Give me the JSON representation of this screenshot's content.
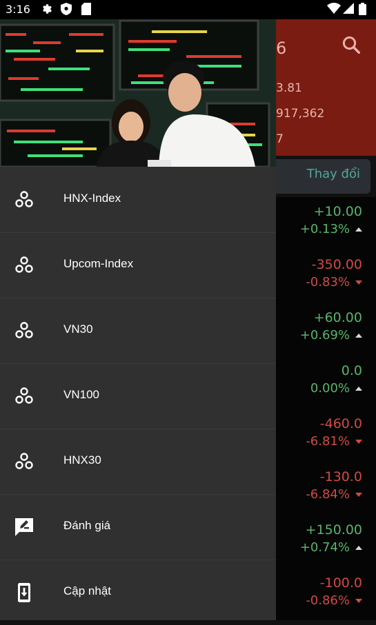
{
  "status_bar": {
    "time": "3:16",
    "icons": [
      "gear-icon",
      "shield-icon",
      "sim-card-icon",
      "wifi-icon",
      "signal-icon",
      "battery-icon"
    ]
  },
  "background": {
    "header_values": [
      "6",
      "3.81",
      "917,362",
      "7"
    ],
    "column_header": "Thay đổi",
    "rows": [
      {
        "value": "+10.00",
        "percent": "+0.13%",
        "direction": "up"
      },
      {
        "value": "-350.00",
        "percent": "-0.83%",
        "direction": "down"
      },
      {
        "value": "+60.00",
        "percent": "+0.69%",
        "direction": "up"
      },
      {
        "value": "0.0",
        "percent": "0.00%",
        "direction": "flat"
      },
      {
        "value": "-460.0",
        "percent": "-6.81%",
        "direction": "down"
      },
      {
        "value": "-130.0",
        "percent": "-6.84%",
        "direction": "down"
      },
      {
        "value": "+150.00",
        "percent": "+0.74%",
        "direction": "up"
      },
      {
        "value": "-100.0",
        "percent": "-0.86%",
        "direction": "down"
      }
    ],
    "colors": {
      "header_bg": "#7a1c12",
      "up": "#58b56b",
      "down": "#d24a45",
      "accent": "#4fa79b"
    }
  },
  "drawer": {
    "menu": [
      {
        "label": "HNX-Index",
        "icon": "workspaces-icon"
      },
      {
        "label": "Upcom-Index",
        "icon": "workspaces-icon"
      },
      {
        "label": "VN30",
        "icon": "workspaces-icon"
      },
      {
        "label": "VN100",
        "icon": "workspaces-icon"
      },
      {
        "label": "HNX30",
        "icon": "workspaces-icon"
      },
      {
        "label": "Đánh giá",
        "icon": "rate-review-icon"
      },
      {
        "label": "Cập nhật",
        "icon": "system-update-icon"
      }
    ]
  }
}
